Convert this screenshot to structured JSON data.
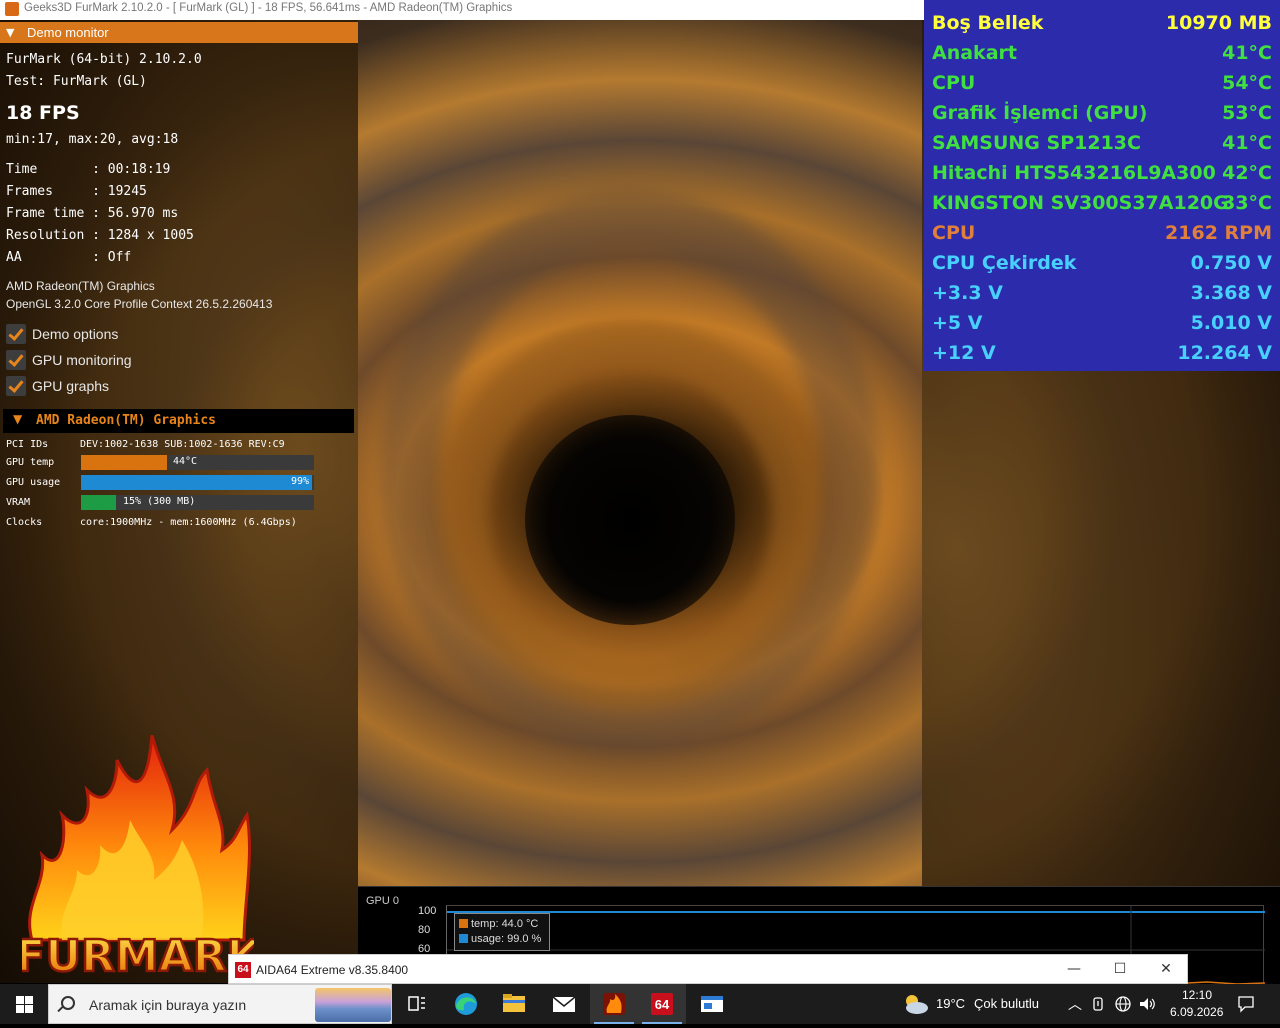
{
  "window": {
    "title": "Geeks3D FurMark 2.10.2.0 - [ FurMark (GL) ] - 18 FPS, 56.641ms - AMD Radeon(TM) Graphics"
  },
  "demo": {
    "header": "Demo monitor",
    "app_line": "FurMark (64-bit) 2.10.2.0",
    "test_line": "Test: FurMark (GL)",
    "fps": "18 FPS",
    "fps_stats": "min:17, max:20, avg:18",
    "stats": [
      {
        "label": "Time       :",
        "value": "00:18:19"
      },
      {
        "label": "Frames     :",
        "value": "19245"
      },
      {
        "label": "Frame time :",
        "value": "56.970 ms"
      },
      {
        "label": "Resolution :",
        "value": "1284 x 1005"
      },
      {
        "label": "AA         :",
        "value": "Off"
      }
    ],
    "gpu_name": "AMD Radeon(TM) Graphics",
    "gl_context": "OpenGL 3.2.0 Core Profile Context 26.5.2.260413",
    "options": [
      {
        "label": "Demo options",
        "checked": true
      },
      {
        "label": "GPU monitoring",
        "checked": true
      },
      {
        "label": "GPU graphs",
        "checked": true
      }
    ]
  },
  "gpu_panel": {
    "header": "AMD Radeon(TM) Graphics",
    "pci_label": "PCI IDs",
    "pci_value": "DEV:1002-1638 SUB:1002-1636 REV:C9",
    "temp_label": "GPU temp",
    "temp_value": "44°C",
    "temp_fraction": 0.37,
    "usage_label": "GPU usage",
    "usage_value": "99%",
    "usage_fraction": 0.99,
    "vram_label": "VRAM",
    "vram_value": "15% (300 MB)",
    "vram_fraction": 0.15,
    "clocks_label": "Clocks",
    "clocks_value": "core:1900MHz - mem:1600MHz (6.4Gbps)"
  },
  "logo": {
    "text": "FURMARK"
  },
  "osd": {
    "rows": [
      {
        "name": "Boş Bellek",
        "value": "10970 MB",
        "color": "#ffff3a"
      },
      {
        "name": "Anakart",
        "value": "41°C",
        "color": "#3fe03f"
      },
      {
        "name": "CPU",
        "value": "54°C",
        "color": "#3fe03f"
      },
      {
        "name": "Grafik İşlemci (GPU)",
        "value": "53°C",
        "color": "#3fe03f"
      },
      {
        "name": "SAMSUNG SP1213C",
        "value": "41°C",
        "color": "#3fe03f"
      },
      {
        "name": "Hitachi HTS543216L9A300",
        "value": "42°C",
        "color": "#3fe03f"
      },
      {
        "name": "KINGSTON SV300S37A120G",
        "value": "33°C",
        "color": "#3fe03f"
      },
      {
        "name": "CPU",
        "value": "2162 RPM",
        "color": "#e0803a"
      },
      {
        "name": "CPU Çekirdek",
        "value": "0.750 V",
        "color": "#48d0ff"
      },
      {
        "name": "+3.3 V",
        "value": "3.368 V",
        "color": "#48d0ff"
      },
      {
        "name": "+5 V",
        "value": "5.010 V",
        "color": "#48d0ff"
      },
      {
        "name": "+12 V",
        "value": "12.264 V",
        "color": "#48d0ff"
      }
    ]
  },
  "graph": {
    "title": "GPU 0",
    "yticks": [
      "100",
      "80",
      "60"
    ],
    "legend": [
      {
        "label": "temp: 44.0 °C",
        "color": "#d9730f"
      },
      {
        "label": "usage: 99.0 %",
        "color": "#1f8ad4"
      }
    ]
  },
  "aida_window": {
    "icon": "64",
    "title": "AIDA64 Extreme v8.35.8400"
  },
  "taskbar": {
    "search_placeholder": "Aramak için buraya yazın",
    "weather_temp": "19°C",
    "weather_text": "Çok bulutlu",
    "time": "12:10",
    "date": "6.09.2026"
  },
  "colors": {
    "accent": "#d7761b",
    "osd_bg": "#2c2bab",
    "usage_bar": "#1f8ad4",
    "vram_bar": "#1e9b45"
  }
}
